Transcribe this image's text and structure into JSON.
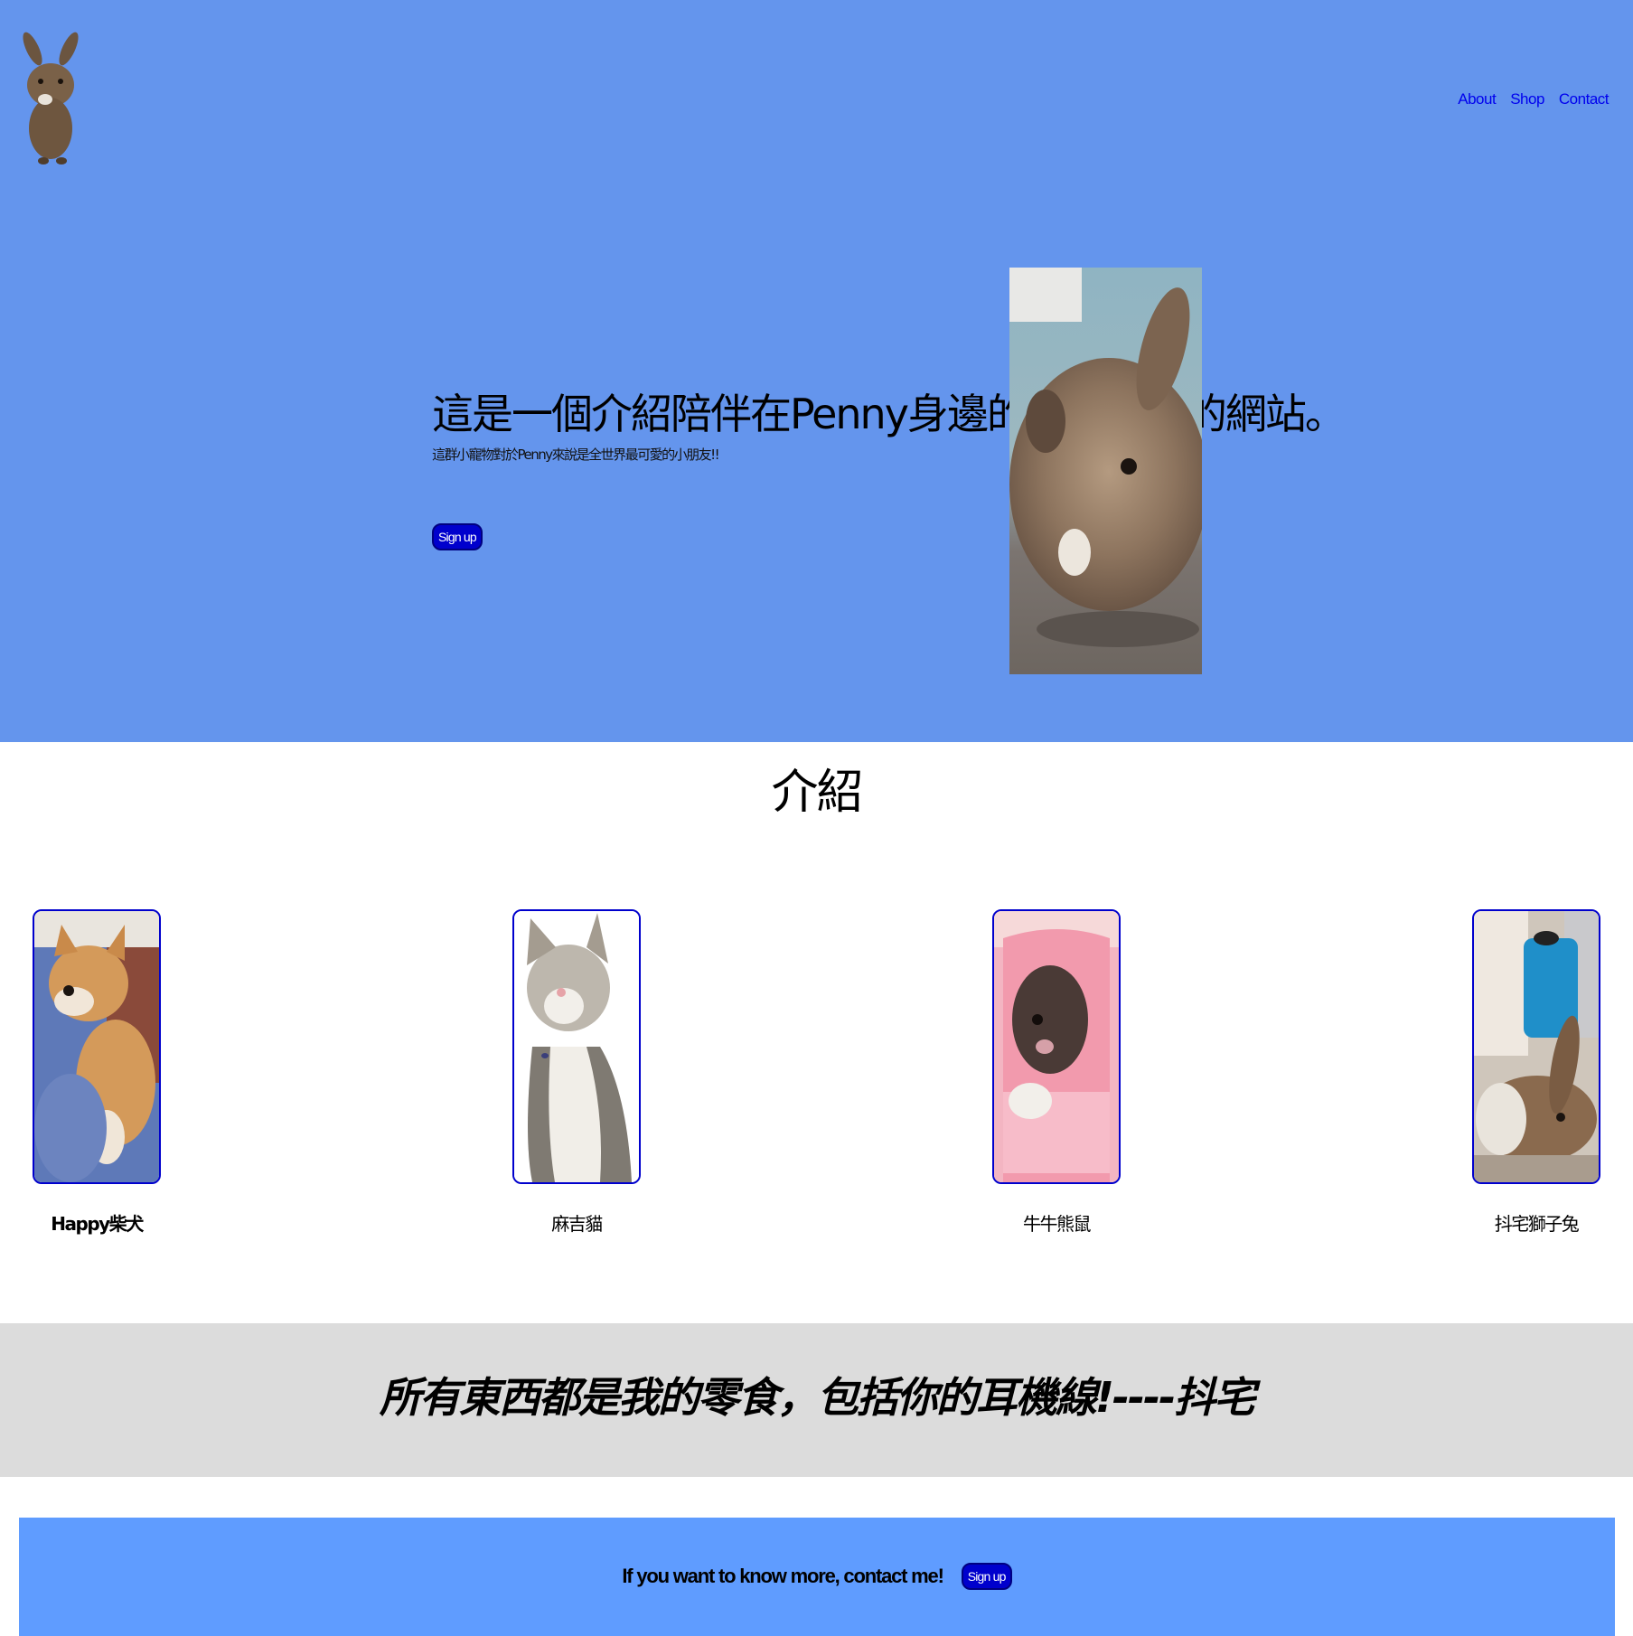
{
  "nav": {
    "links": [
      "About",
      "Shop",
      "Contact"
    ]
  },
  "hero": {
    "title": "這是一個介紹陪伴在Penny身邊的小寵物們的網站。",
    "subtitle": "這群小寵物對於Penny來說是全世界最可愛的小朋友!!",
    "button_label": "Sign up"
  },
  "intro": {
    "title": "介紹",
    "pets": [
      {
        "name": "Happy柴犬"
      },
      {
        "name": "麻吉貓"
      },
      {
        "name": "牛牛熊鼠"
      },
      {
        "name": "抖宅獅子兔"
      }
    ]
  },
  "quote": {
    "text": "所有東西都是我的零食，包括你的耳機線!----抖宅"
  },
  "cta": {
    "text": "If you want to know more, contact me!",
    "button_label": "Sign up"
  },
  "colors": {
    "hero_bg": "#6495ed",
    "cta_bg": "#5f9cff",
    "quote_bg": "#dcdcdc",
    "button_bg": "#0000cd",
    "link": "#0000ee"
  },
  "icons": {
    "logo": "rabbit-logo-icon"
  }
}
